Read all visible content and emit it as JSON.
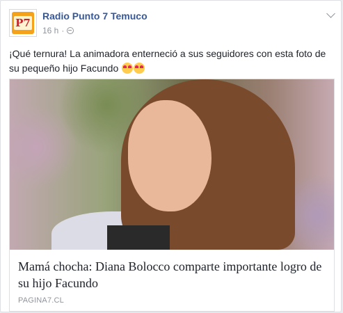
{
  "post": {
    "page_name": "Radio Punto 7 Temuco",
    "avatar_text": "P7",
    "timestamp": "16 h",
    "separator": "·",
    "text": "¡Qué ternura! La animadora enterneció a sus seguidores con esta foto de su pequeño hijo Facundo",
    "emojis": [
      "heart-eyes-emoji",
      "heart-eyes-emoji"
    ]
  },
  "link_card": {
    "title": "Mamá chocha: Diana Bolocco comparte importante logro de su hijo Facundo",
    "domain": "PAGINA7.CL"
  },
  "colors": {
    "link": "#365899",
    "meta": "#90949c",
    "text": "#1d2129",
    "avatar_bg": "#f4a21c"
  }
}
